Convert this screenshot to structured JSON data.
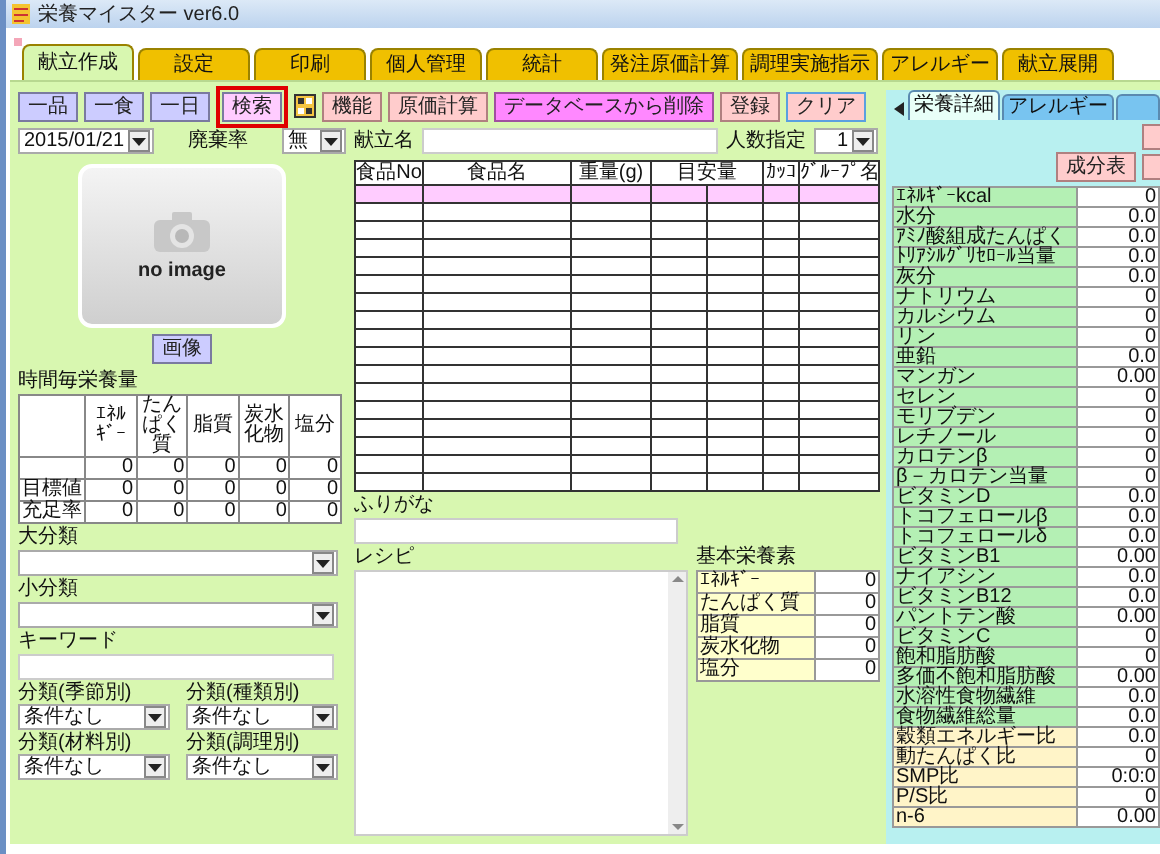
{
  "window": {
    "title": "栄養マイスター ver6.0"
  },
  "tabs": [
    {
      "label": "献立作成",
      "selected": true
    },
    {
      "label": "設定",
      "selected": false
    },
    {
      "label": "印刷",
      "selected": false
    },
    {
      "label": "個人管理",
      "selected": false
    },
    {
      "label": "統計",
      "selected": false
    },
    {
      "label": "発注原価計算",
      "selected": false
    },
    {
      "label": "調理実施指示",
      "selected": false
    },
    {
      "label": "アレルギー",
      "selected": false
    },
    {
      "label": "献立展開",
      "selected": false
    }
  ],
  "toolbar": [
    {
      "kind": "scope",
      "label": "一品",
      "highlighted": false
    },
    {
      "kind": "scope",
      "label": "一食",
      "highlighted": false
    },
    {
      "kind": "scope",
      "label": "一日",
      "highlighted": false
    },
    {
      "kind": "search",
      "label": "検索",
      "highlighted": true
    },
    {
      "kind": "icon"
    },
    {
      "kind": "action",
      "label": "機能",
      "highlighted": false
    },
    {
      "kind": "action",
      "label": "原価計算",
      "highlighted": false
    },
    {
      "kind": "danger",
      "label": "データベースから削除",
      "highlighted": false
    },
    {
      "kind": "action",
      "label": "登録",
      "highlighted": false
    },
    {
      "kind": "clear",
      "label": "クリア",
      "highlighted": false
    }
  ],
  "date": {
    "value": "2015/01/21"
  },
  "waste_rate": {
    "label": "廃棄率",
    "value": "無"
  },
  "menu_name": {
    "label": "献立名"
  },
  "servings": {
    "label": "人数指定",
    "value": "1"
  },
  "image": {
    "caption": "no image",
    "button": "画像"
  },
  "hourly_nutrition": {
    "title": "時間毎栄養量",
    "columns": [
      "ｴﾈﾙｷﾞｰ",
      "たんぱく質",
      "脂質",
      "炭水化物",
      "塩分"
    ],
    "rows": [
      {
        "values": [
          "0",
          "0",
          "0",
          "0",
          "0"
        ]
      },
      {
        "label": "目標値",
        "values": [
          "0",
          "0",
          "0",
          "0",
          "0"
        ]
      },
      {
        "label": "充足率",
        "values": [
          "0",
          "0",
          "0",
          "0",
          "0"
        ]
      }
    ]
  },
  "filters": [
    {
      "kind": "select",
      "label": "大分類"
    },
    {
      "kind": "select",
      "label": "小分類"
    },
    {
      "kind": "text",
      "label": "キーワード"
    }
  ],
  "category_filters": [
    {
      "label": "分類(季節別)",
      "value": "条件なし"
    },
    {
      "label": "分類(種類別)",
      "value": "条件なし"
    },
    {
      "label": "分類(材料別)",
      "value": "条件なし"
    },
    {
      "label": "分類(調理別)",
      "value": "条件なし"
    }
  ],
  "food_table": {
    "columns": [
      "食品No",
      "食品名",
      "重量(g)",
      "目安量",
      "ｶｯｺ",
      "ｸﾞﾙｰﾌﾟ名"
    ],
    "rows": [
      {
        "selected": true
      },
      {
        "selected": false
      },
      {
        "selected": false
      },
      {
        "selected": false
      },
      {
        "selected": false
      },
      {
        "selected": false
      },
      {
        "selected": false
      },
      {
        "selected": false
      },
      {
        "selected": false
      },
      {
        "selected": false
      },
      {
        "selected": false
      },
      {
        "selected": false
      },
      {
        "selected": false
      },
      {
        "selected": false
      },
      {
        "selected": false
      },
      {
        "selected": false
      },
      {
        "selected": false
      }
    ]
  },
  "furigana": {
    "label": "ふりがな"
  },
  "recipe": {
    "label": "レシピ"
  },
  "basic_nutrients": {
    "title": "基本栄養素",
    "rows": [
      {
        "label": "ｴﾈﾙｷﾞｰ",
        "value": "0"
      },
      {
        "label": "たんぱく質",
        "value": "0"
      },
      {
        "label": "脂質",
        "value": "0"
      },
      {
        "label": "炭水化物",
        "value": "0"
      },
      {
        "label": "塩分",
        "value": "0"
      }
    ]
  },
  "side_panel": {
    "tabs": [
      {
        "label": "栄養詳細",
        "selected": true
      },
      {
        "label": "アレルギー",
        "selected": false
      },
      {
        "selected": false
      }
    ],
    "button_rows": [
      [
        {
          "kind": "cut"
        }
      ],
      [
        {
          "kind": "full",
          "label": "成分表"
        },
        {
          "kind": "cut"
        }
      ]
    ],
    "nutrients": [
      {
        "kind": "nutrient",
        "label": "ｴﾈﾙｷﾞｰkcal",
        "value": "0"
      },
      {
        "kind": "nutrient",
        "label": "水分",
        "value": "0.0"
      },
      {
        "kind": "nutrient",
        "label": "ｱﾐﾉ酸組成たんぱく",
        "value": "0.0"
      },
      {
        "kind": "nutrient",
        "label": "ﾄﾘｱｼﾙｸﾞﾘｾﾛｰﾙ当量",
        "value": "0.0"
      },
      {
        "kind": "nutrient",
        "label": "灰分",
        "value": "0.0"
      },
      {
        "kind": "nutrient",
        "label": "ナトリウム",
        "value": "0"
      },
      {
        "kind": "nutrient",
        "label": "カルシウム",
        "value": "0"
      },
      {
        "kind": "nutrient",
        "label": "リン",
        "value": "0"
      },
      {
        "kind": "nutrient",
        "label": "亜鉛",
        "value": "0.0"
      },
      {
        "kind": "nutrient",
        "label": "マンガン",
        "value": "0.00"
      },
      {
        "kind": "nutrient",
        "label": "セレン",
        "value": "0"
      },
      {
        "kind": "nutrient",
        "label": "モリブデン",
        "value": "0"
      },
      {
        "kind": "nutrient",
        "label": "レチノール",
        "value": "0"
      },
      {
        "kind": "nutrient",
        "label": "カロテンβ",
        "value": "0"
      },
      {
        "kind": "nutrient",
        "label": "β－カロテン当量",
        "value": "0"
      },
      {
        "kind": "nutrient",
        "label": "ビタミンD",
        "value": "0.0"
      },
      {
        "kind": "nutrient",
        "label": "トコフェロールβ",
        "value": "0.0"
      },
      {
        "kind": "nutrient",
        "label": "トコフェロールδ",
        "value": "0.0"
      },
      {
        "kind": "nutrient",
        "label": "ビタミンB1",
        "value": "0.00"
      },
      {
        "kind": "nutrient",
        "label": "ナイアシン",
        "value": "0.0"
      },
      {
        "kind": "nutrient",
        "label": "ビタミンB12",
        "value": "0.0"
      },
      {
        "kind": "nutrient",
        "label": "パントテン酸",
        "value": "0.00"
      },
      {
        "kind": "nutrient",
        "label": "ビタミンC",
        "value": "0"
      },
      {
        "kind": "nutrient",
        "label": "飽和脂肪酸",
        "value": "0"
      },
      {
        "kind": "nutrient",
        "label": "多価不飽和脂肪酸",
        "value": "0.00"
      },
      {
        "kind": "nutrient",
        "label": "水溶性食物繊維",
        "value": "0.0"
      },
      {
        "kind": "nutrient",
        "label": "食物繊維総量",
        "value": "0.0"
      },
      {
        "kind": "ratio",
        "label": "穀類エネルギー比",
        "value": "0.0"
      },
      {
        "kind": "ratio",
        "label": "動たんぱく比",
        "value": "0"
      },
      {
        "kind": "ratio",
        "label": "SMP比",
        "value": "0:0:0"
      },
      {
        "kind": "ratio",
        "label": "P/S比",
        "value": "0"
      },
      {
        "kind": "ratio",
        "label": "n-6",
        "value": "0.00"
      }
    ]
  }
}
